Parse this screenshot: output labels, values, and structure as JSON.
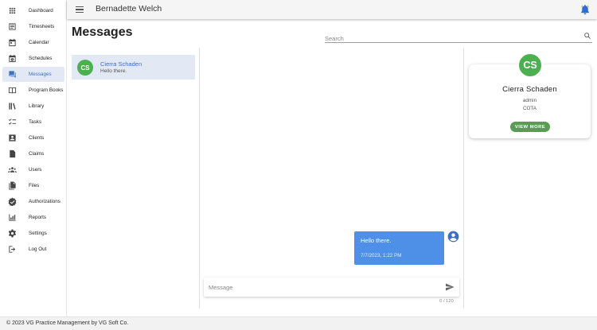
{
  "header": {
    "user_name": "Bernadette Welch"
  },
  "sidebar": {
    "items": [
      {
        "label": "Dashboard",
        "icon": "apps-grid-icon"
      },
      {
        "label": "Timesheets",
        "icon": "timesheet-icon"
      },
      {
        "label": "Calendar",
        "icon": "calendar-icon"
      },
      {
        "label": "Schedules",
        "icon": "schedule-icon"
      },
      {
        "label": "Messages",
        "icon": "chat-icon",
        "active": true
      },
      {
        "label": "Program Books",
        "icon": "book-open-icon"
      },
      {
        "label": "Library",
        "icon": "library-icon"
      },
      {
        "label": "Tasks",
        "icon": "checklist-icon"
      },
      {
        "label": "Clients",
        "icon": "contact-icon"
      },
      {
        "label": "Claims",
        "icon": "claims-icon"
      },
      {
        "label": "Users",
        "icon": "users-icon"
      },
      {
        "label": "Files",
        "icon": "files-icon"
      },
      {
        "label": "Authorizations",
        "icon": "verified-icon"
      },
      {
        "label": "Reports",
        "icon": "bar-chart-icon"
      },
      {
        "label": "Settings",
        "icon": "gear-icon"
      },
      {
        "label": "Log Out",
        "icon": "logout-icon"
      }
    ]
  },
  "page": {
    "title": "Messages"
  },
  "search": {
    "placeholder": "Search"
  },
  "conversations": [
    {
      "initials": "CS",
      "name": "Cierra Schaden",
      "preview": "Hello there."
    }
  ],
  "messages": [
    {
      "text": "Hello there.",
      "time": "7/7/2023, 1:22 PM"
    }
  ],
  "composer": {
    "placeholder": "Message",
    "counter": "0 / 120"
  },
  "profile": {
    "initials": "CS",
    "name": "Cierra Schaden",
    "role": "admin",
    "org": "COTA",
    "button": "VIEW MORE"
  },
  "footer": {
    "text": "© 2023 VG Practice Management by VG Soft Co."
  },
  "colors": {
    "accent": "#3d6fc4",
    "bubble": "#4e8fe8",
    "avatar": "#4caf50",
    "button": "#5a9c55",
    "active_bg": "#e3e9f4"
  }
}
